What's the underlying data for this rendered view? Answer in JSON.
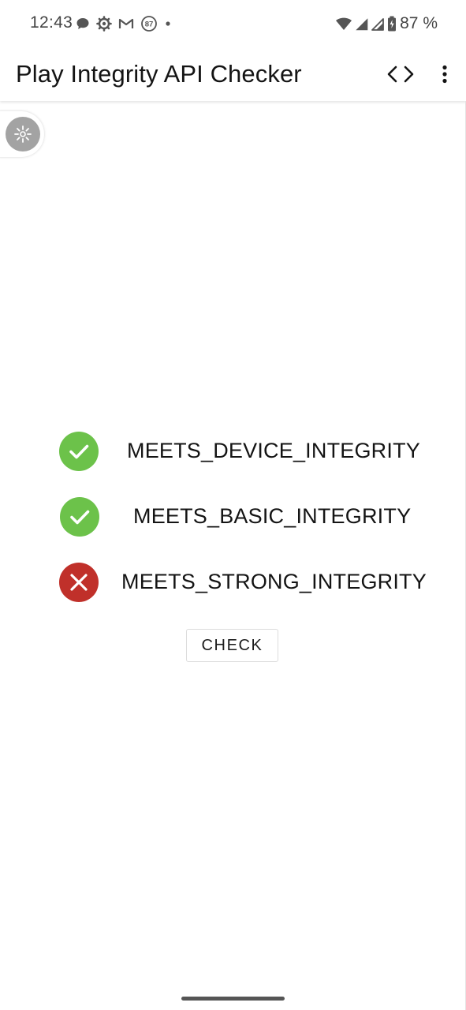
{
  "status_bar": {
    "time": "12:43",
    "battery": "87 %",
    "notification_badge": "87",
    "left_icons": [
      "chat-bubble-icon",
      "settings-gear-icon",
      "gmail-icon",
      "badge-87-icon",
      "dot-icon"
    ],
    "right_icons": [
      "wifi-icon",
      "signal-icon",
      "signal-icon",
      "battery-icon"
    ]
  },
  "app_bar": {
    "title": "Play Integrity API Checker",
    "actions": [
      "code-icon",
      "more-vert-icon"
    ]
  },
  "results": [
    {
      "label": "MEETS_DEVICE_INTEGRITY",
      "status": "pass",
      "icon": "check-circle-icon"
    },
    {
      "label": "MEETS_BASIC_INTEGRITY",
      "status": "pass",
      "icon": "check-circle-icon"
    },
    {
      "label": "MEETS_STRONG_INTEGRITY",
      "status": "fail",
      "icon": "cancel-circle-icon"
    }
  ],
  "check_button": {
    "label": "CHECK"
  },
  "colors": {
    "pass": "#6cc24a",
    "fail": "#c0302a",
    "fab": "#a3a3a3",
    "text": "#141414",
    "status_text": "#444444"
  }
}
